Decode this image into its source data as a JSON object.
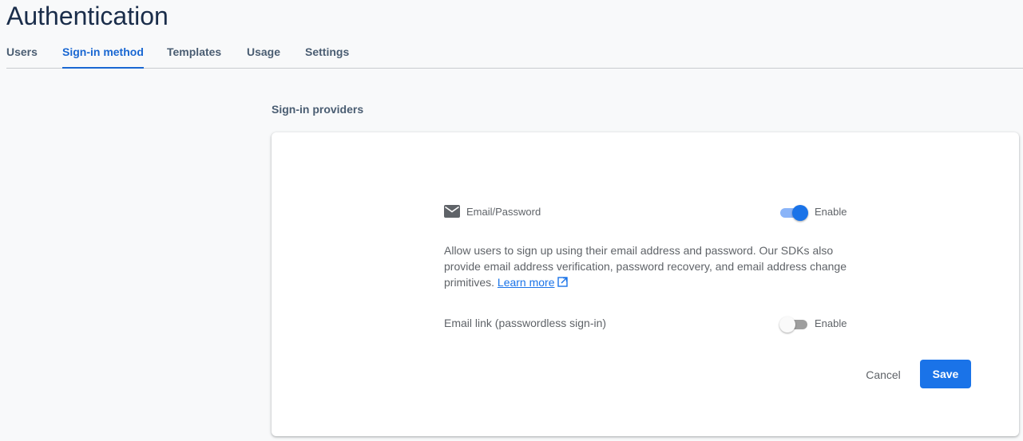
{
  "page": {
    "title": "Authentication"
  },
  "tabs": [
    {
      "label": "Users",
      "active": false
    },
    {
      "label": "Sign-in method",
      "active": true
    },
    {
      "label": "Templates",
      "active": false
    },
    {
      "label": "Usage",
      "active": false
    },
    {
      "label": "Settings",
      "active": false
    }
  ],
  "section": {
    "title": "Sign-in providers"
  },
  "providers": {
    "email_password": {
      "icon": "mail-icon",
      "label": "Email/Password",
      "enabled": true,
      "toggle_label": "Enable"
    },
    "description": {
      "text": "Allow users to sign up using their email address and password. Our SDKs also provide email address verification, password recovery, and email address change primitives.",
      "learn_more": "Learn more",
      "learn_more_icon": "external-link-icon"
    },
    "email_link": {
      "label": "Email link (passwordless sign-in)",
      "enabled": false,
      "toggle_label": "Enable"
    }
  },
  "actions": {
    "cancel_label": "Cancel",
    "save_label": "Save"
  },
  "colors": {
    "accent": "#1a73e8",
    "title": "#1a2d4a",
    "tab_text": "#4a5d72"
  }
}
